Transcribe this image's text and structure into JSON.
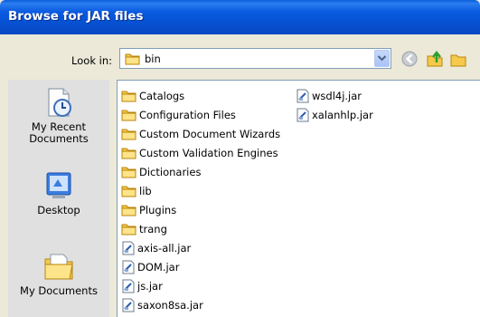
{
  "window": {
    "title": "Browse for JAR files"
  },
  "look_in": {
    "label": "Look in:",
    "value": "bin"
  },
  "places": [
    {
      "label": "My Recent Documents",
      "icon": "recent-documents-icon"
    },
    {
      "label": "Desktop",
      "icon": "desktop-icon"
    },
    {
      "label": "My Documents",
      "icon": "my-documents-icon"
    }
  ],
  "files": {
    "column1": [
      {
        "name": "Catalogs",
        "type": "folder"
      },
      {
        "name": "Configuration Files",
        "type": "folder"
      },
      {
        "name": "Custom Document Wizards",
        "type": "folder"
      },
      {
        "name": "Custom Validation Engines",
        "type": "folder"
      },
      {
        "name": "Dictionaries",
        "type": "folder"
      },
      {
        "name": "lib",
        "type": "folder"
      },
      {
        "name": "Plugins",
        "type": "folder"
      },
      {
        "name": "trang",
        "type": "folder"
      },
      {
        "name": "axis-all.jar",
        "type": "jar"
      },
      {
        "name": "DOM.jar",
        "type": "jar"
      },
      {
        "name": "js.jar",
        "type": "jar"
      },
      {
        "name": "saxon8sa.jar",
        "type": "jar"
      }
    ],
    "column2": [
      {
        "name": "wsdl4j.jar",
        "type": "jar"
      },
      {
        "name": "xalanhlp.jar",
        "type": "jar"
      }
    ]
  },
  "colors": {
    "title_bar": "#0a5ae0",
    "dialog_background": "#ece9d8",
    "places_background": "#e0e0e0",
    "folder": "#f5c94b"
  }
}
